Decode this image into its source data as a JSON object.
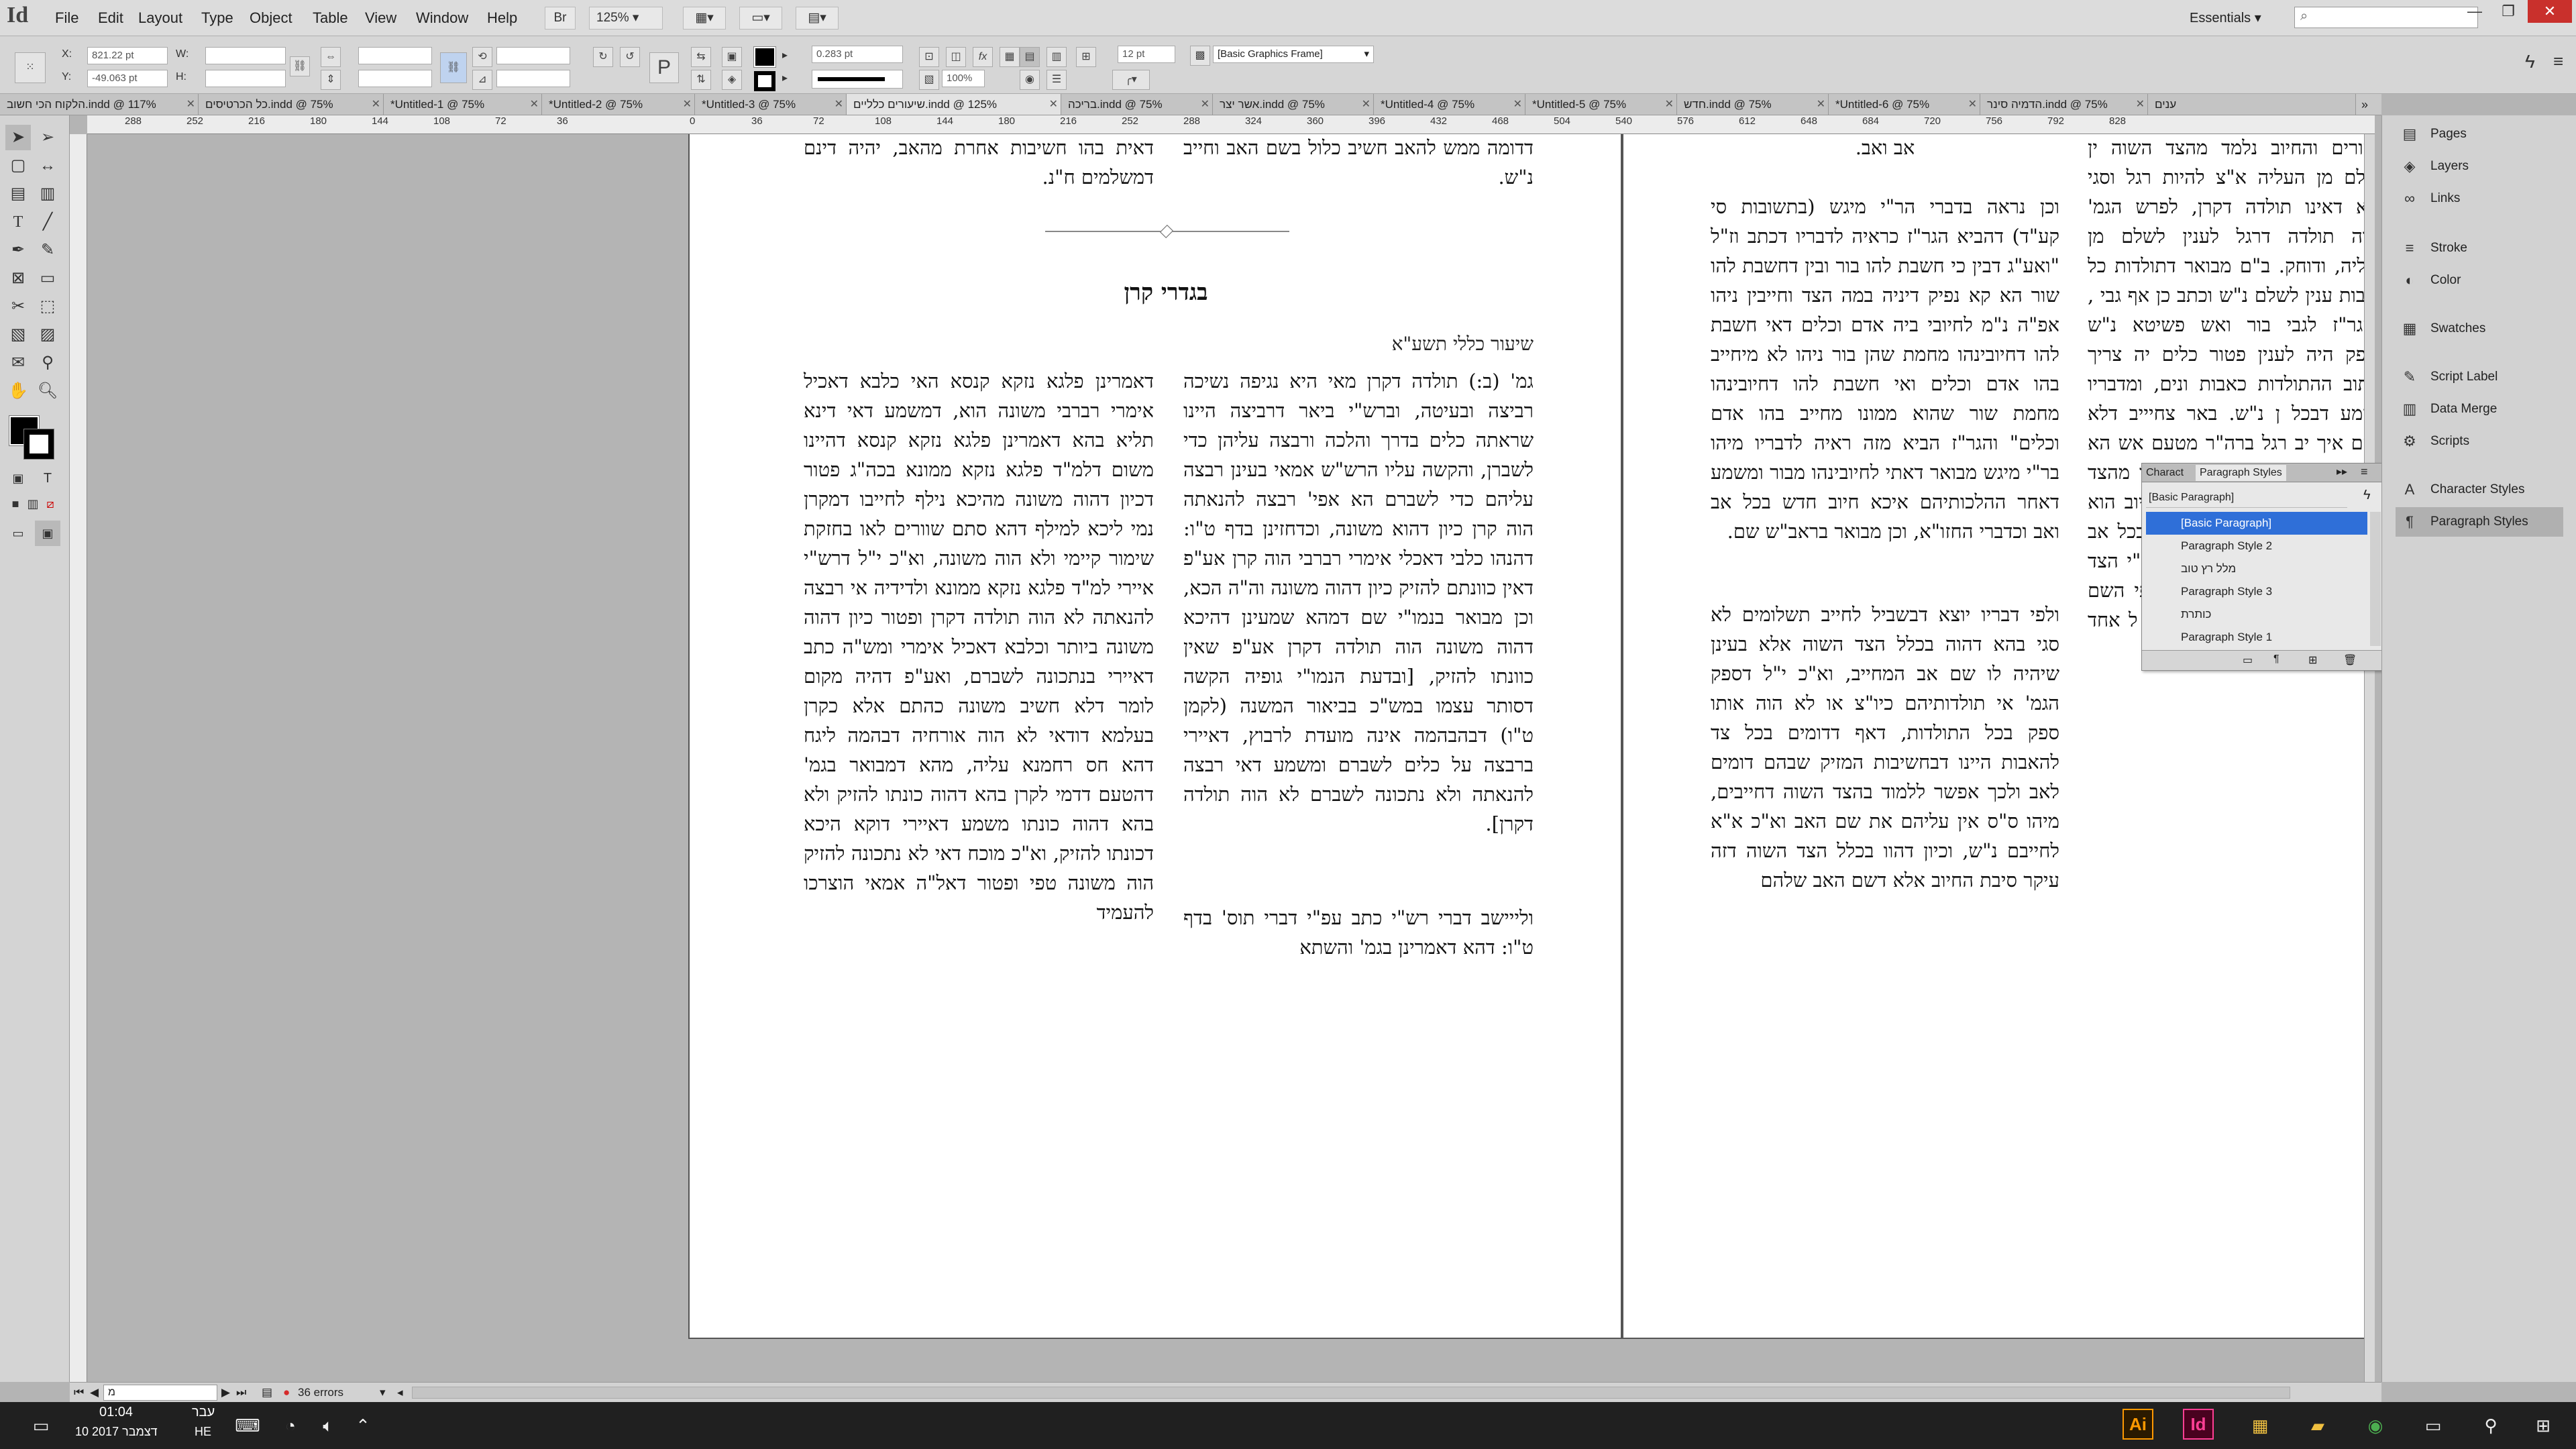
{
  "app": {
    "logo": "Id"
  },
  "menu": [
    "File",
    "Edit",
    "Layout",
    "Type",
    "Object",
    "Table",
    "View",
    "Window",
    "Help"
  ],
  "menubar_extras": {
    "br_label": "Br",
    "zoom": "125%",
    "workspace": "Essentials",
    "search_placeholder": ""
  },
  "control": {
    "x_value": "821.22 pt",
    "y_value": "-49.063 pt",
    "w_value": "",
    "h_value": "",
    "x_label": "X:",
    "y_label": "Y:",
    "w_label": "W:",
    "h_label": "H:",
    "stroke_weight": "0.283 pt",
    "scale_value": "100%",
    "gutter_value": "12 pt",
    "frame_style": "[Basic Graphics Frame]"
  },
  "tabs": [
    "הלקוח הכי חשוב.indd @ 117% ",
    "כל הכרטיסים.indd @ 75% ",
    "*Untitled-1 @ 75% ",
    "*Untitled-2 @ 75% ",
    "*Untitled-3 @ 75% ",
    "שיעורים כלליים.indd @ 125%",
    "בריכה.indd @ 75% ",
    "אשר יצר.indd @ 75% ",
    "*Untitled-4 @ 75% ",
    "*Untitled-5 @ 75% ",
    "חדש.indd @ 75% ",
    "*Untitled-6 @ 75% ",
    "הדמיה סינר.indd @ 75% ",
    "ענים"
  ],
  "ruler_ticks": [
    "288",
    "252",
    "216",
    "180",
    "144",
    "108",
    "72",
    "36",
    "0",
    "36",
    "72",
    "108",
    "144",
    "180",
    "216",
    "252",
    "288",
    "324",
    "360",
    "396",
    "432",
    "468",
    "504",
    "540",
    "576",
    "612",
    "648",
    "684",
    "720",
    "756",
    "792",
    "828"
  ],
  "document": {
    "left_col1_top": "דאית בהו חשיבות אחרת מהאב, יהיה דינם דמשלמים ח\"נ.",
    "left_col2_top": "דדומה ממש להאב חשיב כלול בשם האב וחייב נ\"ש.",
    "heading": "בגדרי קרן",
    "subheading": "שיעור כללי תשע\"א",
    "left_col2_body": "גמ' (ב:) תולדה דקרן מאי היא נגיפה נשיכה רביצה ובעיטה, וברש\"י ביאר דרביצה היינו שראתה כלים בדרך והלכה ורבצה עליהן כדי לשברן, והקשה עליו הרש\"ש אמאי בעינן רבצה עליהם כדי לשברם הא אפי' רבצה להנאתה הוה קרן כיון דהוא משונה, וכדחזינן בדף ט\"ו: דהנהו כלבי דאכלי אימרי רברבי הוה קרן אע\"פ דאין כוונתם להזיק כיון דהוה משונה וה\"ה הכא, וכן מבואר בנמו\"י שם דמהא שמעינן דהיכא דהוה משונה הוה תולדה דקרן אע\"פ שאין כוונתו להזיק, [ובדעת הנמו\"י גופיה הקשה דסותר עצמו במש\"כ בביאור המשנה (לקמן ט\"ו) דבהבהמה אינה מועדת לרבוץ, דאיירי ברבצה על כלים לשברם ומשמע דאי רבצה להנאתה ולא נתכונה לשברם לא הוה תולדה דקרן].",
    "left_col2_bottom": "ולייישב דברי רש\"י כתב עפ\"י דברי תוס' בדף ט\"ו: דהא דאמרינן בגמ' והשתא",
    "left_col1_body": "דאמרינן פלגא נזקא קנסא האי כלבא דאכיל אימרי רברבי משונה הוא, דמשמע דאי דינא תליא בהא דאמרינן פלגא נזקא קנסא דהיינו משום דלמ\"ד פלגא נזקא ממונא בכה\"ג פטור דכיון דהוה משונה מהיכא נילף לחייבו דמקרן נמי ליכא למילף דהא סתם שוורים לאו בחזקת שימור קיימי ולא הוה משונה, וא\"כ י\"ל דרש\"י איירי למ\"ד פלגא נזקא ממונא ולדידיה אי רבצה להנאתה לא הוה תולדה דקרן ופטור כיון דהוה משונה ביותר וכלבא דאכיל אימרי ומש\"ה כתב דאיירי בנתכונה לשברם, ואע\"פ דהיה מקום לומר דלא חשיב משונה כהתם אלא כקרן בעלמא דודאי לא הוה אורחיה דבהמה ליגח דהא חס רחמנא עליה, מהא דמבואר בגמ' דהטעם דדמי לקרן בהא דהוה כונתו להזיק ולא בהא דהוה כונתו משמע דאיירי דוקא היכא דכונתו להזיק, וא\"כ מוכח דאי לא נתכונה להזיק הוה משונה טפי ופטור דאל\"ה אמאי הוצרכו להעמיד",
    "right_col1_top": "אב ואב.",
    "right_col1_body": "וכן נראה בדברי הר\"י מיגש (בתשובות סי קע\"ד) דהביא הגר\"ז כראיה לדבריו דכתב וז\"ל \"ואע\"ג דבין כי חשבת להו בור ובין דחשבת להו שור הא קא נפיק דיניה במה הצד וחייבין ניהו אפ\"ה נ\"מ לחיובי ביה אדם וכלים דאי חשבת להו דחיובינהו מחמת שהן בור ניהו לא מיחייב בהו אדם וכלים ואי חשבת להו דחיובינהו מחמת שור שהוא ממונו מחייב בהו אדם וכלים\" והגר\"ז הביא מזה ראיה לדבריו מיהו בר\"י מיגש מבואר דאתי לחיובינהו מבור ומשמע דאחר ההלכותיהם איכא חיוב חדש בכל אב ואב וכדברי החזו\"א, וכן מבואר בראב\"ש שם.",
    "right_col1_body2": "ולפי דבריו יוצא דבשביל לחייב תשלומים לא סגי בהא דהוה בכלל הצד השוה אלא בעינן שיהיה לו שם אב המחייב, וא\"כ י\"ל דספק הגמ' אי תולדותיהם כיו\"צ או לא הוה אותו ספק בכל התולדות, דאף דדומים בכל צד להאבות היינו דבחשיבות המזיק שבהם דומים לאב ולכך אפשר ללמוד בהצד השוה דחייבים, מיהו ס\"ס אין עליהם את שם האב וא\"כ א\"א לחייבם נ\"ש, וכיון דהוו בכלל הצד השוה דזה עיקר סיבת החיוב אלא דשם האב שלהם",
    "right_col2_body": "השורים והחיוב נלמד מהצד השוה ין לשלם מן העליה א\"צ להיות רגל וסגי בהא דאינו תולדה דקרן, לפרש הגמ' דהוה תולדה דרגל לענין לשלם מן העליה, ודוחק. ב\"ם מבואר דתולדות כל האבות ענין לשלם נ\"ש וכתב כן אף גבי , ולהגר\"ז לגבי בור ואש פשיטא נ\"ש הספק היה לענין פטור כלים יה צריך לכתוב ההתולדות כאבות ונים, ומדבריו משמע דבכל ן נ\"ש. באר צחיייב דלא השם איך יב רגל ברה\"ר מטעם אש הא ין דנאמר ברגל לפטור ברה\"ר וד מהצד השוה, וע\"כ דס\"ל דאף יבת החיוב הוא מהצד השוה, בכדי הלכותיהם דבכל אב ואב אמרה ן חיוב כל המזיקים ע\"י הצד השוה א כל אב ואב מתחייב לפי השם וזהו כל חיובו וחיוב זה הוה חיוב ל אחד ואחד לפי דינו דאש אינו"
  },
  "panels": {
    "items": [
      "Pages",
      "Layers",
      "Links",
      "Stroke",
      "Color",
      "Swatches",
      "Script Label",
      "Data Merge",
      "Scripts",
      "Character Styles",
      "Paragraph Styles"
    ]
  },
  "pstyles": {
    "tab1": "Charact",
    "tab2": "Paragraph Styles",
    "current": "[Basic Paragraph]",
    "rows": [
      "[Basic Paragraph]",
      "Paragraph Style 2",
      "מלל רץ טוב",
      "Paragraph Style 3",
      "כותרת",
      "Paragraph Style 1"
    ]
  },
  "status": {
    "page": "מ",
    "errors": "36 errors"
  },
  "taskbar": {
    "time": "01:04",
    "date": "10 דצמבר 2017",
    "lang1": "עבר",
    "lang2": "HE"
  }
}
